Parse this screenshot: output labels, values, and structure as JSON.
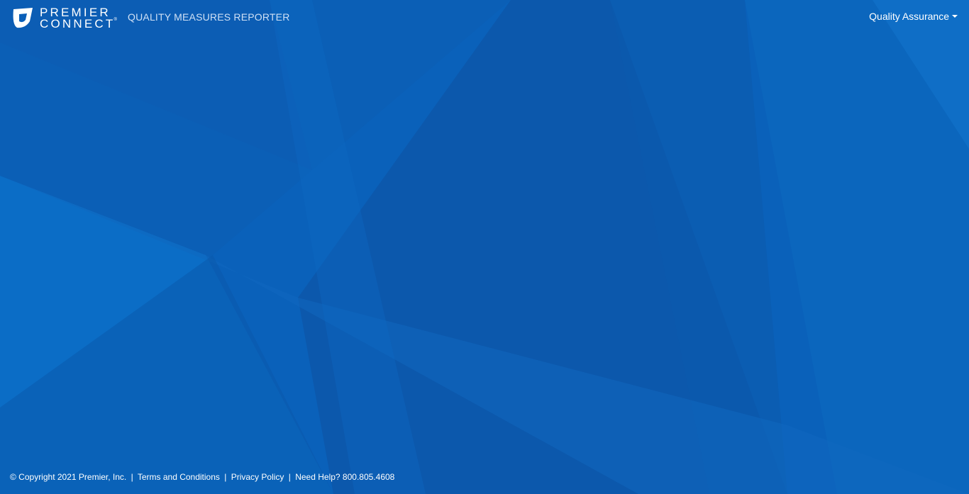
{
  "header": {
    "logo_line1": "PREMIER",
    "logo_line2": "CONNECT",
    "logo_registered": "®",
    "app_title": "QUALITY MEASURES REPORTER",
    "user_menu_label": "Quality Assurance"
  },
  "footer": {
    "copyright": "© Copyright 2021 Premier, Inc.",
    "separator": "|",
    "terms_link": "Terms and Conditions",
    "privacy_link": "Privacy Policy",
    "help_text": "Need Help? 800.805.4608"
  },
  "colors": {
    "background": "#0a5fb8",
    "text": "#ffffff",
    "app_title": "#cfe0f5"
  },
  "icons": {
    "logo": "premier-connect-logo-icon",
    "user_menu_caret": "caret-down-icon"
  }
}
